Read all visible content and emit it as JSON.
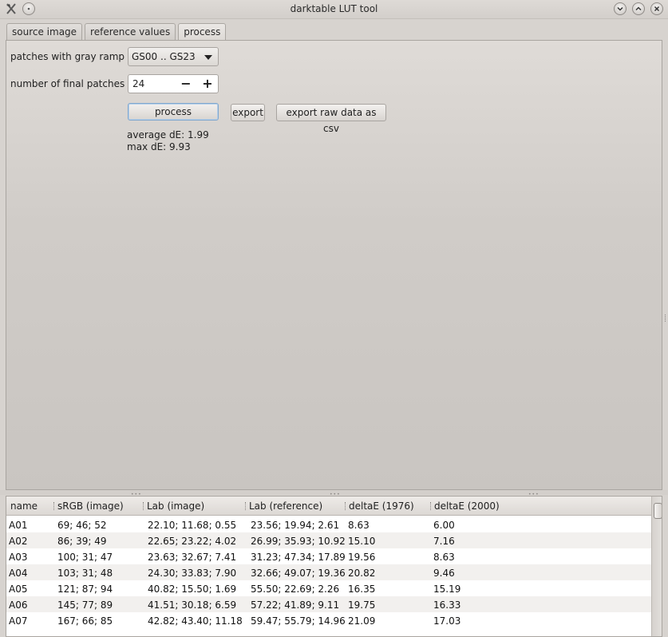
{
  "window": {
    "title": "darktable LUT tool"
  },
  "tabs": [
    {
      "label": "source image"
    },
    {
      "label": "reference values"
    },
    {
      "label": "process"
    }
  ],
  "process": {
    "gray_ramp_label": "patches with gray ramp",
    "gray_ramp_value": "GS00 .. GS23",
    "final_patches_label": "number of final patches",
    "final_patches_value": "24",
    "process_label": "process",
    "export_label": "export",
    "export_csv_label": "export raw data as csv",
    "average_de": "average dE: 1.99",
    "max_de": "max dE: 9.93"
  },
  "table": {
    "columns": [
      "name",
      "sRGB (image)",
      "Lab (image)",
      "Lab (reference)",
      "deltaE (1976)",
      "deltaE (2000)"
    ],
    "rows": [
      [
        "A01",
        "69; 46; 52",
        "22.10; 11.68; 0.55",
        "23.56; 19.94; 2.61",
        "8.63",
        "6.00"
      ],
      [
        "A02",
        "86; 39; 49",
        "22.65; 23.22; 4.02",
        "26.99; 35.93; 10.92",
        "15.10",
        "7.16"
      ],
      [
        "A03",
        "100; 31; 47",
        "23.63; 32.67; 7.41",
        "31.23; 47.34; 17.89",
        "19.56",
        "8.63"
      ],
      [
        "A04",
        "103; 31; 48",
        "24.30; 33.83; 7.90",
        "32.66; 49.07; 19.36",
        "20.82",
        "9.46"
      ],
      [
        "A05",
        "121; 87; 94",
        "40.82; 15.50; 1.69",
        "55.50; 22.69; 2.26",
        "16.35",
        "15.19"
      ],
      [
        "A06",
        "145; 77; 89",
        "41.51; 30.18; 6.59",
        "57.22; 41.89; 9.11",
        "19.75",
        "16.33"
      ],
      [
        "A07",
        "167; 66; 85",
        "42.82; 43.40; 11.18",
        "59.47; 55.79; 14.96",
        "21.09",
        "17.03"
      ]
    ]
  },
  "icons": {
    "app": "darktable-app-icon",
    "menu": "window-menu-icon",
    "minimize": "chevron-down-icon",
    "maximize": "chevron-up-icon",
    "close": "close-icon",
    "combo_arrow": "triangle-down-icon",
    "minus": "minus-icon",
    "plus": "plus-icon"
  },
  "colors": {
    "focus_border": "#7fa7cf",
    "window_bg": "#d7d3cf"
  }
}
